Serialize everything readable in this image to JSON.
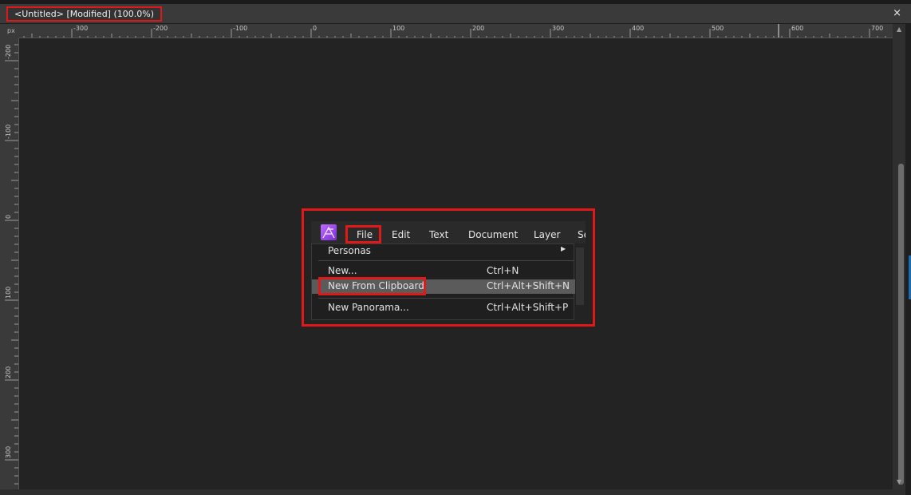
{
  "document_tab": {
    "title": "<Untitled>  [Modified]  (100.0%)",
    "close_label": "×"
  },
  "ruler": {
    "unit": "px",
    "horizontal_ticks": [
      "-300",
      "-200",
      "-100",
      "0",
      "100",
      "200",
      "300",
      "400",
      "500",
      "600",
      "700"
    ],
    "vertical_ticks": [
      "-200",
      "-100",
      "0",
      "100",
      "200",
      "300"
    ]
  },
  "menu_screenshot": {
    "menubar": [
      "File",
      "Edit",
      "Text",
      "Document",
      "Layer",
      "Se"
    ],
    "file_menu": {
      "personas": "Personas",
      "new": {
        "label": "New...",
        "shortcut": "Ctrl+N"
      },
      "new_from_clipboard": {
        "label": "New From Clipboard",
        "shortcut": "Ctrl+Alt+Shift+N"
      },
      "new_panorama": {
        "label": "New Panorama...",
        "shortcut": "Ctrl+Alt+Shift+P"
      }
    }
  },
  "colors": {
    "highlight": "#e01818",
    "canvas": "#232323",
    "panel": "#3a3a3a",
    "logo": "#a855f7"
  },
  "icons": {
    "app_logo": "affinity-publisher-logo-icon",
    "close": "close-icon",
    "submenu": "chevron-right-icon"
  }
}
